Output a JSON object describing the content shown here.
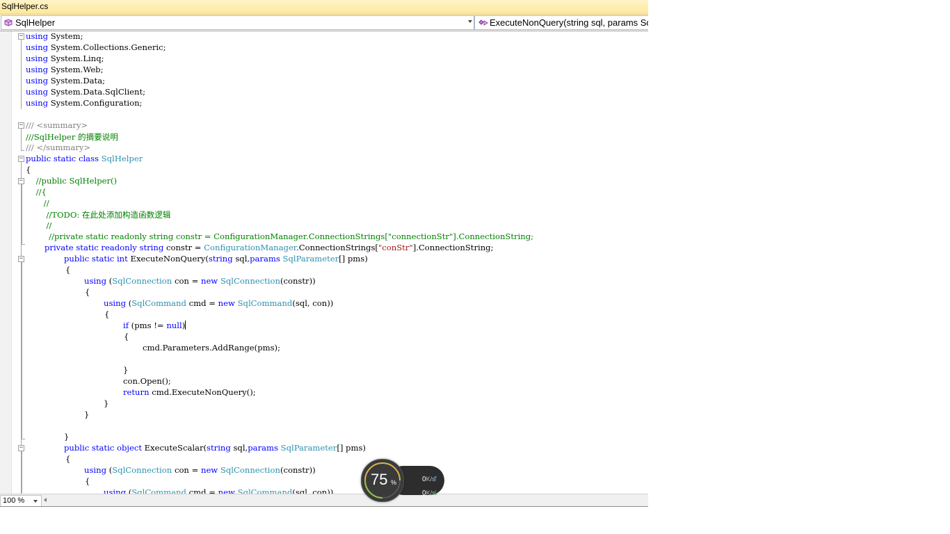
{
  "tab": {
    "title": "SqlHelper.cs"
  },
  "nav": {
    "class_dropdown": "SqlHelper",
    "member_dropdown": "ExecuteNonQuery(string sql, params SqlParameter[] pms)"
  },
  "status": {
    "zoom": "100 %"
  },
  "widget": {
    "cpu_percent": "75",
    "percent_sign": "%",
    "upload_value": "0",
    "download_value": "0",
    "speed_unit": "K/s"
  },
  "colors": {
    "keyword": "#0000ff",
    "type": "#2b91af",
    "comment": "#008000",
    "string": "#a31515",
    "tab_bg": "#fde89a"
  },
  "code": {
    "l01": {
      "a": "using",
      "b": " System;"
    },
    "l02": {
      "a": "using",
      "b": " System.Collections.Generic;"
    },
    "l03": {
      "a": "using",
      "b": " System.Linq;"
    },
    "l04": {
      "a": "using",
      "b": " System.Web;"
    },
    "l05": {
      "a": "using",
      "b": " System.Data;"
    },
    "l06": {
      "a": "using",
      "b": " System.Data.SqlClient;"
    },
    "l07": {
      "a": "using",
      "b": " System.Configuration;"
    },
    "l09": {
      "a": "/// ",
      "b": "<summary>"
    },
    "l10": {
      "a": "///SqlHelper 的摘要说明"
    },
    "l11": {
      "a": "/// ",
      "b": "</summary>"
    },
    "l12": {
      "a": "public static class",
      "b": " ",
      "c": "SqlHelper"
    },
    "l13": {
      "a": "{"
    },
    "l14": {
      "a": "    //public SqlHelper()"
    },
    "l15": {
      "a": "    //{"
    },
    "l16": {
      "a": "       //"
    },
    "l17": {
      "a": "        //TODO: 在此处添加构造函数逻辑"
    },
    "l18": {
      "a": "        //"
    },
    "l19": {
      "a": "         //private static readonly string constr = ConfigurationManager.ConnectionStrings[\"connectionStr\"].ConnectionString;"
    },
    "l20": {
      "a": "private static readonly string",
      "b": " constr = ",
      "c": "ConfigurationManager",
      "d": ".ConnectionStrings[",
      "e": "\"conStr\"",
      "f": "].ConnectionString;"
    },
    "l21": {
      "a": "public static int",
      "b": " ExecuteNonQuery(",
      "c": "string",
      "d": " sql,",
      "e": "params",
      "f": " ",
      "g": "SqlParameter",
      "h": "[] pms)"
    },
    "l22": {
      "a": "{"
    },
    "l23": {
      "a": "using",
      "b": " (",
      "c": "SqlConnection",
      "d": " con = ",
      "e": "new",
      "f": " ",
      "g": "SqlConnection",
      "h": "(constr))"
    },
    "l24": {
      "a": "{"
    },
    "l25": {
      "a": "using",
      "b": " (",
      "c": "SqlCommand",
      "d": " cmd = ",
      "e": "new",
      "f": " ",
      "g": "SqlCommand",
      "h": "(sql, con))"
    },
    "l26": {
      "a": "{"
    },
    "l27": {
      "a": "if",
      "b": " (pms != ",
      "c": "null",
      "d": ")"
    },
    "l28": {
      "a": "{"
    },
    "l29": {
      "a": "cmd.Parameters.AddRange(pms);"
    },
    "l31": {
      "a": "}"
    },
    "l32": {
      "a": "con.Open();"
    },
    "l33": {
      "a": "return",
      "b": " cmd.ExecuteNonQuery();"
    },
    "l34": {
      "a": "}"
    },
    "l35": {
      "a": "}"
    },
    "l37": {
      "a": "}"
    },
    "l38": {
      "a": "public static object",
      "b": " ExecuteScalar(",
      "c": "string",
      "d": " sql,",
      "e": "params",
      "f": " ",
      "g": "SqlParameter",
      "h": "[] pms)"
    },
    "l39": {
      "a": "{"
    },
    "l40": {
      "a": "using",
      "b": " (",
      "c": "SqlConnection",
      "d": " con = ",
      "e": "new",
      "f": " ",
      "g": "SqlConnection",
      "h": "(constr))"
    },
    "l41": {
      "a": "{"
    },
    "l42": {
      "a": "using",
      "b": " (",
      "c": "SqlCommand",
      "d": " cmd = ",
      "e": "new",
      "f": " ",
      "g": "SqlCommand",
      "h": "(sql, con))"
    }
  }
}
